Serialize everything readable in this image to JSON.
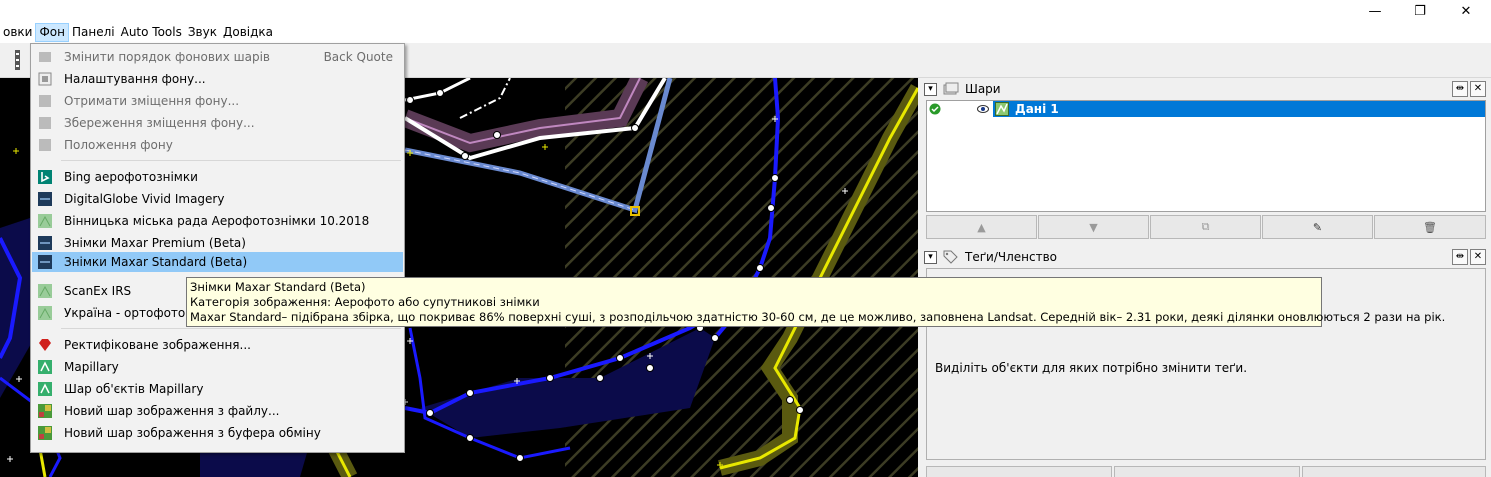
{
  "window": {
    "minimize_glyph": "—",
    "restore_glyph": "❐",
    "close_glyph": "✕"
  },
  "menubar": {
    "items": [
      "овки",
      "Фон",
      "Панелі",
      "Auto Tools",
      "Звук",
      "Довідка"
    ]
  },
  "background_menu": {
    "items": [
      {
        "label": "Змінити порядок фонових шарів",
        "shortcut": "Back Quote",
        "disabled": true,
        "icon": "layers-order-icon"
      },
      {
        "label": "Налаштування фону...",
        "disabled": false,
        "icon": "settings-icon"
      },
      {
        "label": "Отримати зміщення фону...",
        "disabled": true,
        "icon": "offset-get-icon"
      },
      {
        "label": "Збереження зміщення фону...",
        "disabled": true,
        "icon": "offset-save-icon"
      },
      {
        "label": "Положення фону",
        "disabled": true,
        "icon": "position-icon"
      },
      {
        "label": "Bing аерофотознімки",
        "disabled": false,
        "icon": "bing-icon"
      },
      {
        "label": "DigitalGlobe Vivid Imagery",
        "disabled": false,
        "icon": "imagery-icon"
      },
      {
        "label": "Вінницька міська рада Аерофотознімки 10.2018",
        "disabled": false,
        "icon": "generic-imagery-icon"
      },
      {
        "label": "Знімки Maxar Premium (Beta)",
        "disabled": false,
        "icon": "maxar-icon"
      },
      {
        "label": "Знімки Maxar Standard (Beta)",
        "disabled": false,
        "highlighted": true,
        "icon": "maxar-icon"
      },
      {
        "label": "ScanEx IRS",
        "disabled": false,
        "icon": "generic-imagery-icon"
      },
      {
        "label": "Україна - ортофотоплан",
        "disabled": false,
        "icon": "generic-imagery-icon"
      },
      {
        "label": "Ректифіковане зображення...",
        "disabled": false,
        "icon": "red-pin-icon"
      },
      {
        "label": "Mapillary",
        "disabled": false,
        "icon": "mapillary-icon"
      },
      {
        "label": "Шар об'єктів Mapillary",
        "disabled": false,
        "icon": "mapillary-icon"
      },
      {
        "label": "Новий шар зображення з файлу...",
        "disabled": false,
        "icon": "image-file-icon"
      },
      {
        "label": "Новий шар зображення з буфера обміну",
        "disabled": false,
        "icon": "image-clipboard-icon"
      }
    ]
  },
  "tooltip": {
    "title": "Знімки Maxar Standard (Beta)",
    "category": "Категорія зображення: Аерофото або супутникові знімки",
    "description": "Maxar Standard– підібрана збірка, що покриває 86% поверхні суші, з розподільчою здатністю 30-60 см, де це можливо, заповнена Landsat. Середній вік– 2.31 роки, деякі ділянки оновлюються 2 рази на рік."
  },
  "layers_panel": {
    "title": "Шари",
    "layer_name": "Дані 1"
  },
  "tags_panel": {
    "title": "Теґи/Членство",
    "hint": "Виділіть об'єкти для яких потрібно змінити теґи."
  },
  "colors": {
    "accent_blue": "#0078d7",
    "highlight": "#91c9f7",
    "tooltip_bg": "#ffffe1",
    "map_bg": "#000000"
  }
}
